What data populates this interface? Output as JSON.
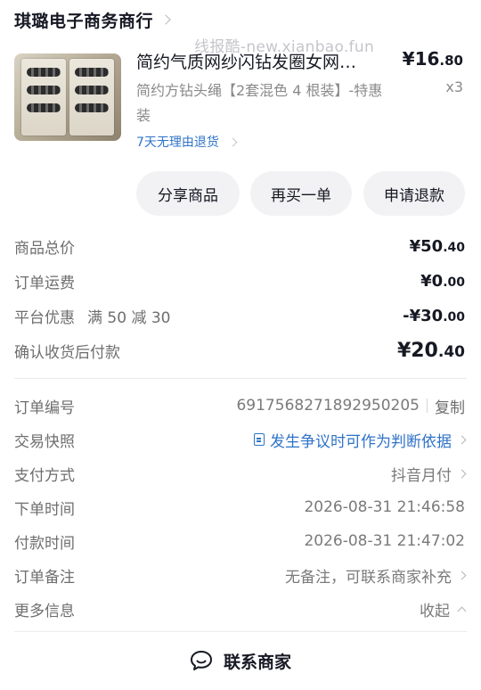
{
  "shop": {
    "name": "琪璐电子商务商行"
  },
  "watermark": "线报酷-new.xianbao.fun",
  "product": {
    "title": "简约气质网纱闪钻发圈女网…",
    "price_int": "¥16",
    "price_dec": ".80",
    "spec": "简约方钻头绳【2套混色 4 根装】-特惠装",
    "qty": "x3",
    "refund_tag": "7天无理由退货"
  },
  "actions": {
    "share": "分享商品",
    "rebuy": "再买一单",
    "refund": "申请退款"
  },
  "summary": {
    "total_label": "商品总价",
    "total_int": "¥50",
    "total_dec": ".40",
    "shipping_label": "订单运费",
    "shipping_int": "¥0",
    "shipping_dec": ".00",
    "discount_label": "平台优惠",
    "discount_note": "满 50 减 30",
    "discount_int": "-¥30",
    "discount_dec": ".00",
    "paid_label": "确认收货后付款",
    "paid_int": "¥20",
    "paid_dec": ".40"
  },
  "info": {
    "order_no_label": "订单编号",
    "order_no": "6917568271892950205",
    "copy": "复制",
    "snapshot_label": "交易快照",
    "snapshot": "发生争议时可作为判断依据",
    "pay_label": "支付方式",
    "pay": "抖音月付",
    "order_time_label": "下单时间",
    "order_time": "2026-08-31 21:46:58",
    "pay_time_label": "付款时间",
    "pay_time": "2026-08-31 21:47:02",
    "remark_label": "订单备注",
    "remark": "无备注，可联系商家补充",
    "more_label": "更多信息",
    "more": "收起"
  },
  "contact": {
    "label": "联系商家"
  }
}
